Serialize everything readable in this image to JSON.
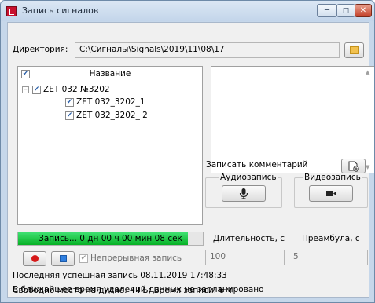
{
  "window": {
    "title": "Запись сигналов"
  },
  "directory": {
    "label": "Директория:",
    "value": "C:\\Сигналы\\Signals\\2019\\11\\08\\17"
  },
  "tree": {
    "header": "Название",
    "root": "ZET 032 №3202",
    "children": [
      "ZET 032_3202_1",
      "ZET 032_3202_ 2"
    ]
  },
  "comment": {
    "label": "Записать комментарий"
  },
  "audio": {
    "label": "Аудиозапись"
  },
  "video": {
    "label": "Видеозапись"
  },
  "progress": {
    "text": "Запись... 0 дн 00 ч 00 мин 08 сек",
    "fraction": 0.92,
    "color": "#06b025"
  },
  "duration": {
    "label": "Длительность, с",
    "value": "100"
  },
  "preamble": {
    "label": "Преамбула, с",
    "value": "5"
  },
  "continuous": {
    "label": "Непрерывная запись"
  },
  "status": {
    "last_record": "Последняя успешная запись 08.11.2019 17:48:33",
    "free_space": "Свободно места на диске: 4 ГБ; Время записи: 6 ч.",
    "deletion": "В ближайшее время удалений данных не запланировано"
  },
  "icons": [
    "app-icon",
    "minimize-icon",
    "maximize-icon",
    "close-icon",
    "folder-icon",
    "add-comment-icon",
    "microphone-icon",
    "video-camera-icon",
    "record-icon",
    "stop-icon"
  ],
  "colors": {
    "record": "#d61a1a",
    "stop": "#2f7fe0",
    "progress": "#06b025"
  }
}
